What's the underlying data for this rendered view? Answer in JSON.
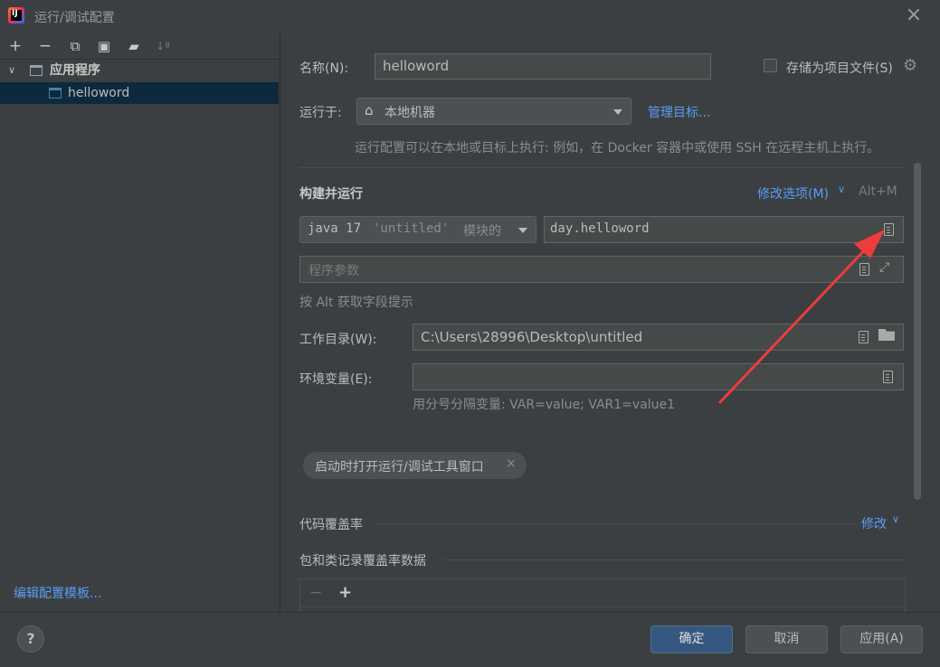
{
  "window": {
    "title": "运行/调试配置",
    "close_icon": "×"
  },
  "toolbar": {
    "add": "+",
    "remove": "−",
    "copy": "⧉",
    "save": "▣",
    "folder": "▰",
    "sort": "↓ª"
  },
  "tree": {
    "root_label": "应用程序",
    "child_label": "helloword",
    "expand_icon": "∨"
  },
  "left_footer": {
    "edit_templates": "编辑配置模板..."
  },
  "form": {
    "name_label": "名称(N):",
    "name_value": "helloword",
    "store_as_file_label": "存储为项目文件(S)",
    "run_on_label": "运行于:",
    "run_on_value": "本地机器",
    "manage_targets": "管理目标...",
    "run_on_hint": "运行配置可以在本地或目标上执行: 例如，在 Docker 容器中或使用 SSH 在远程主机上执行。",
    "build_run_title": "构建并运行",
    "modify_options": "修改选项(M)",
    "modify_shortcut": "Alt+M",
    "jdk_java": "java 17",
    "jdk_module": "'untitled'",
    "jdk_suffix": "模块的",
    "main_class": "day.helloword",
    "program_args_placeholder": "程序参数",
    "alt_hint": "按 Alt 获取字段提示",
    "workdir_label": "工作目录(W):",
    "workdir_value": "C:\\Users\\28996\\Desktop\\untitled",
    "env_label": "环境变量(E):",
    "env_value": "",
    "env_hint": "用分号分隔变量: VAR=value; VAR1=value1",
    "chip_label": "启动时打开运行/调试工具窗口",
    "chip_close": "×",
    "coverage_title": "代码覆盖率",
    "coverage_modify": "修改",
    "coverage_packages": "包和类记录覆盖率数据",
    "cov_minus": "−",
    "cov_plus": "+"
  },
  "buttons": {
    "help": "?",
    "ok": "确定",
    "cancel": "取消",
    "apply": "应用(A)"
  },
  "colors": {
    "accent_link": "#589df6",
    "ok_button": "#365880",
    "selection": "#0d293e",
    "annotation_arrow": "#ee3b3b"
  }
}
